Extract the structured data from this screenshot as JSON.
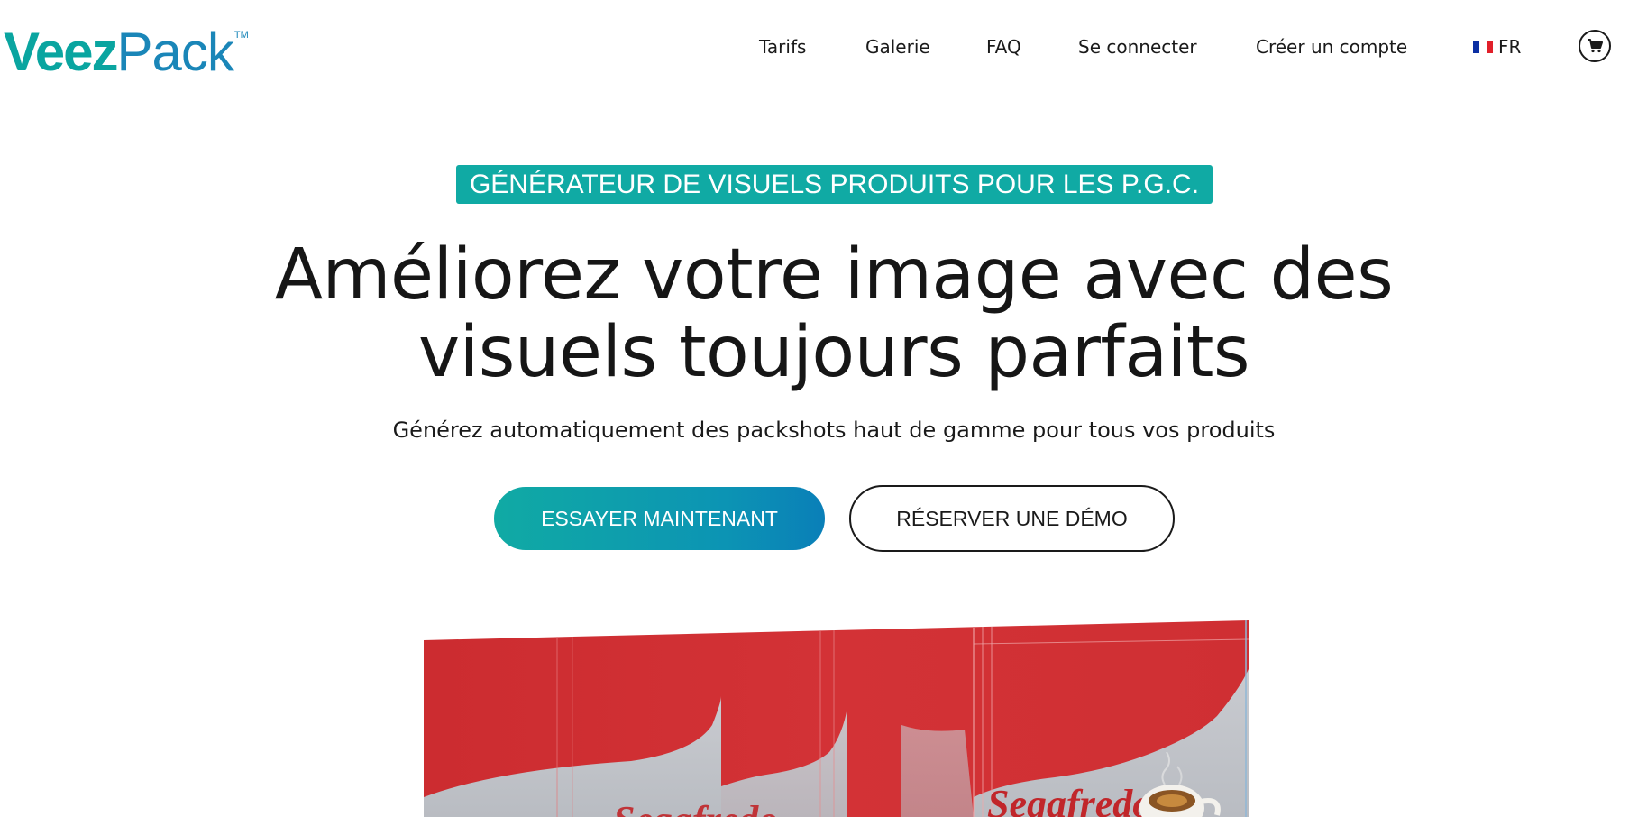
{
  "header": {
    "logo": {
      "part1": "Veez",
      "part2": "Pack",
      "tm": "TM"
    },
    "nav": [
      {
        "label": "Tarifs"
      },
      {
        "label": "Galerie"
      },
      {
        "label": "FAQ"
      },
      {
        "label": "Se connecter"
      },
      {
        "label": "Créer un compte"
      }
    ],
    "language": "FR",
    "cart_icon": "cart-icon"
  },
  "hero": {
    "badge": "GÉNÉRATEUR DE VISUELS PRODUITS POUR LES P.G.C.",
    "headline_line1": "Améliorez votre image avec des",
    "headline_line2": "visuels toujours parfaits",
    "subline": "Générez automatiquement des packshots haut de gamme pour tous vos produits",
    "cta_primary": "ESSAYER MAINTENANT",
    "cta_secondary": "RÉSERVER UNE DÉMO"
  },
  "product": {
    "brand_text": "Segafredo"
  },
  "colors": {
    "accent_teal": "#10aaa4",
    "accent_blue": "#0a7fb8",
    "product_red": "#cf2f33",
    "text": "#1a1a1a"
  }
}
